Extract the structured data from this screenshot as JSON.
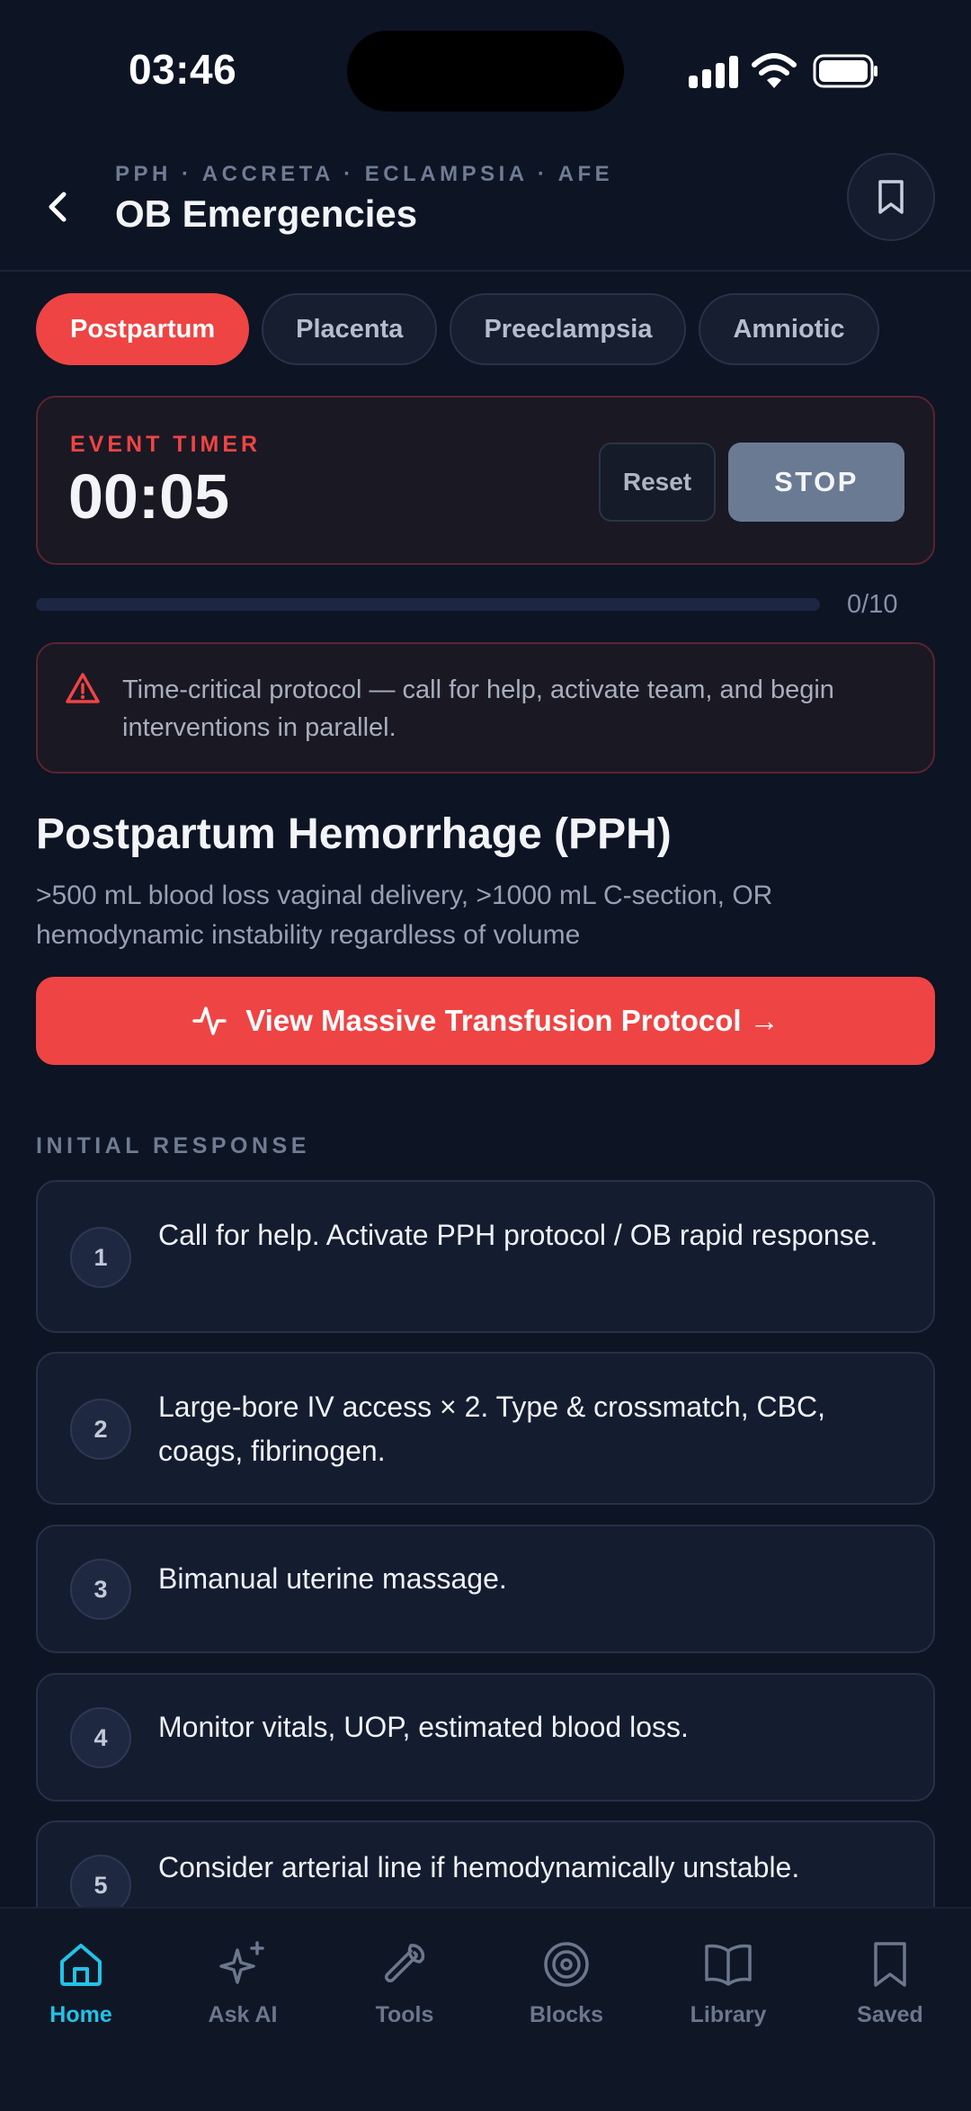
{
  "status": {
    "time": "03:46"
  },
  "header": {
    "subtitle": "PPH · ACCRETA · ECLAMPSIA · AFE",
    "title": "OB Emergencies"
  },
  "tabs": [
    {
      "label": "Postpartum",
      "active": true
    },
    {
      "label": "Placenta",
      "active": false
    },
    {
      "label": "Preeclampsia",
      "active": false
    },
    {
      "label": "Amniotic",
      "active": false
    }
  ],
  "timer": {
    "label": "EVENT TIMER",
    "value": "00:05",
    "reset_label": "Reset",
    "stop_label": "STOP"
  },
  "progress": {
    "text": "0/10",
    "completed": 0,
    "total": 10
  },
  "alert": {
    "text": "Time-critical protocol — call for help, activate team, and begin interventions in parallel."
  },
  "section": {
    "title": "Postpartum Hemorrhage (PPH)",
    "description": ">500 mL blood loss vaginal delivery, >1000 mL C-section, OR hemodynamic instability regardless of volume",
    "mtp_button": "View Massive Transfusion Protocol →"
  },
  "group_label": "INITIAL RESPONSE",
  "steps": [
    {
      "num": "1",
      "text": "Call for help. Activate PPH protocol / OB rapid response."
    },
    {
      "num": "2",
      "text": "Large-bore IV access × 2. Type & crossmatch, CBC, coags, fibrinogen."
    },
    {
      "num": "3",
      "text": "Bimanual uterine massage."
    },
    {
      "num": "4",
      "text": "Monitor vitals, UOP, estimated blood loss."
    },
    {
      "num": "5",
      "text": "Consider arterial line if hemodynamically unstable."
    }
  ],
  "nav": [
    {
      "label": "Home",
      "icon": "home-icon",
      "active": true
    },
    {
      "label": "Ask AI",
      "icon": "sparkle-icon",
      "active": false
    },
    {
      "label": "Tools",
      "icon": "wrench-icon",
      "active": false
    },
    {
      "label": "Blocks",
      "icon": "target-icon",
      "active": false
    },
    {
      "label": "Library",
      "icon": "book-icon",
      "active": false
    },
    {
      "label": "Saved",
      "icon": "bookmark-icon",
      "active": false
    }
  ],
  "colors": {
    "accent_red": "#ef4444",
    "accent_cyan": "#22c3e6",
    "background": "#0d1424"
  }
}
